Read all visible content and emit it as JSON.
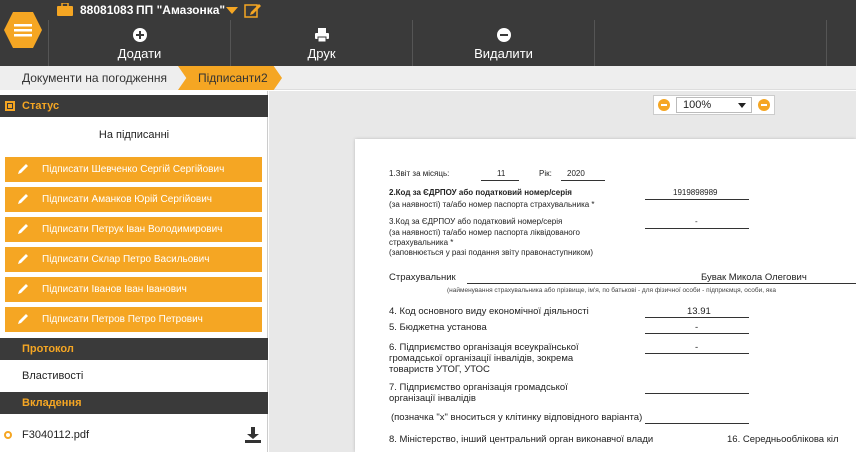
{
  "header": {
    "account": "88081083",
    "org": "ПП \"Амазонка\""
  },
  "toolbar": {
    "add_label": "Додати",
    "print_label": "Друк",
    "delete_label": "Видалити"
  },
  "breadcrumb": {
    "items": [
      "Документи на погодження",
      "Підписанти2"
    ]
  },
  "sidebar": {
    "status_title": "Статус",
    "status_value": "На підписанні",
    "signers": [
      "Підписати Шевченко Сергій Сергійович",
      "Підписати Аманков Юрій Сергійович",
      "Підписати Петрук Іван Володимирович",
      "Підписати Склар Петро Васильович",
      "Підписати Іванов Іван Іванович",
      "Підписати Петров Петро Петрович"
    ],
    "protocol_title": "Протокол",
    "properties_label": "Властивості",
    "attachments_title": "Вкладення",
    "file_name": "F3040112.pdf"
  },
  "viewer": {
    "zoom": "100%"
  },
  "document": {
    "l1": "1.Звіт за місяць:",
    "month": "11",
    "year_label": "Рік:",
    "year": "2020",
    "l2a": "2.Код за ЄДРПОУ або податковий номер/серія",
    "l2b": "(за наявності) та/або номер паспорта страхувальника *",
    "code": "1919898989",
    "l3a": "3.Код за ЄДРПОУ або податковий номер/серія",
    "l3b": "(за наявності) та/або номер паспорта ліквідованого",
    "l3c": "страхувальника *",
    "l3d": "(заповнюється у разі подання звіту правонаступником)",
    "l3val": "-",
    "insurer_label": "Страхувальник",
    "insurer": "Бувак Микола Олегович",
    "insurer_note": "(найменування страхувальника або прізвище, ім'я, по батькові - для фізичної особи - підприємця, особи, яка",
    "l4": "4. Код основного виду економічної діяльності",
    "kved": "13.91",
    "l5": "5. Бюджетна установа",
    "l5val": "-",
    "l6a": "6. Підприємство організація всеукраїнської",
    "l6b": "громадської організації інвалідів, зокрема",
    "l6c": "товариств УТОГ, УТОС",
    "l6val": "-",
    "l7a": "7. Підприємство організація громадської",
    "l7b": "організації інвалідів",
    "l7note": "(позначка \"х\" вноситься у клітинку відповідного варіанта)",
    "l8": "8. Міністерство, інший центральний орган виконавчої влади",
    "l16": "16. Середньооблікова кіл"
  },
  "colors": {
    "accent": "#f5a623",
    "dark": "#3a3a3a"
  }
}
